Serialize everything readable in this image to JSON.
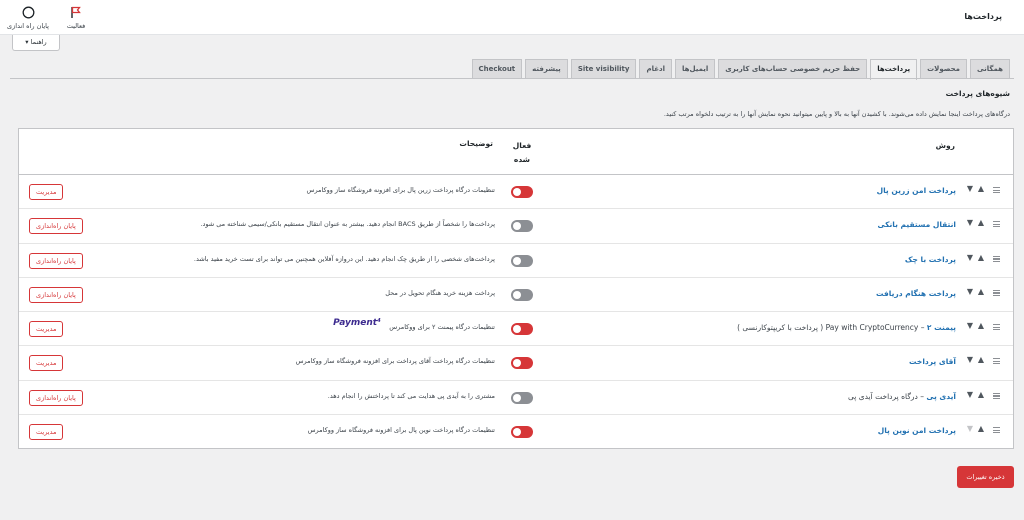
{
  "header": {
    "title": "پرداخت‌ها",
    "activity_label": "فعالیت",
    "finish_setup_label": "پایان راه اندازی",
    "help_label": "راهنما ▾"
  },
  "tabs": [
    {
      "label": "همگانی",
      "active": false
    },
    {
      "label": "محصولات",
      "active": false
    },
    {
      "label": "پرداخت‌ها",
      "active": true
    },
    {
      "label": "حفظ حریم خصوصی حساب‌های کاربری",
      "active": false
    },
    {
      "label": "ایمیل‌ها",
      "active": false
    },
    {
      "label": "ادغام",
      "active": false
    },
    {
      "label": "Site visibility",
      "active": false
    },
    {
      "label": "پیشرفته",
      "active": false
    },
    {
      "label": "Checkout",
      "active": false
    }
  ],
  "section": {
    "title": "شیوه‌های پرداخت",
    "description": "درگاه‌های پرداخت اینجا نمایش داده می‌شوند. با کشیدن آنها به بالا و پایین میتوانید نحوه نمایش آنها را به ترتیب دلخواه مرتب کنید."
  },
  "table": {
    "col_method": "روش",
    "col_enabled": "فعال شده",
    "col_description": "توضیحات"
  },
  "gateways": [
    {
      "name": "پرداخت امن زرین پال",
      "sub": "",
      "enabled": true,
      "description": "تنظیمات درگاه پرداخت زرین پال برای افزونه فروشگاه ساز ووکامرس",
      "action": "مدیریت",
      "logo": "",
      "down_dim": false
    },
    {
      "name": "انتقال مستقیم بانکی",
      "sub": "",
      "enabled": false,
      "description": "پرداخت‌ها را شخصاً از طریق BACS انجام دهید. بیشتر به عنوان انتقال مستقیم بانکی/سیمی شناخته می شود.",
      "action": "پایان راه‌اندازی",
      "logo": "",
      "down_dim": false
    },
    {
      "name": "پرداخت با چک",
      "sub": "",
      "enabled": false,
      "description": "پرداخت‌های شخصی را از طریق چک انجام دهید. این دروازه آفلاین همچنین می تواند برای تست خرید مفید باشد.",
      "action": "پایان راه‌اندازی",
      "logo": "",
      "down_dim": false
    },
    {
      "name": "پرداخت هنگام دریافت",
      "sub": "",
      "enabled": false,
      "description": "پرداخت هزینه خرید هنگام تحویل در محل",
      "action": "پایان راه‌اندازی",
      "logo": "",
      "down_dim": false
    },
    {
      "name": "پیمنت ۲",
      "sub": " – Pay with CryptoCurrency ( پرداخت با کریپتوکارنسی )",
      "enabled": true,
      "description": "تنظیمات درگاه پیمنت ۲ برای ووکامرس",
      "action": "مدیریت",
      "logo": "Payment⁴",
      "down_dim": false
    },
    {
      "name": "آقای پرداخت",
      "sub": "",
      "enabled": true,
      "description": "تنظیمات درگاه پرداخت آقای پرداخت برای افزونه فروشگاه ساز ووکامرس",
      "action": "مدیریت",
      "logo": "",
      "down_dim": false
    },
    {
      "name": "آیدی پی",
      "sub": " – درگاه پرداخت آیدی پی",
      "enabled": false,
      "description": "مشتری را به آیدی پی هدایت می کند تا پرداختش را انجام دهد.",
      "action": "پایان راه‌اندازی",
      "logo": "",
      "down_dim": false
    },
    {
      "name": "پرداخت امن نوین پال",
      "sub": "",
      "enabled": true,
      "description": "تنظیمات درگاه پرداخت نوین پال برای افزونه فروشگاه ساز ووکامرس",
      "action": "مدیریت",
      "logo": "",
      "down_dim": true
    }
  ],
  "footer": {
    "save_label": "ذخیره تغییرات"
  },
  "colors": {
    "accent": "#d63638",
    "link": "#2271b1"
  }
}
